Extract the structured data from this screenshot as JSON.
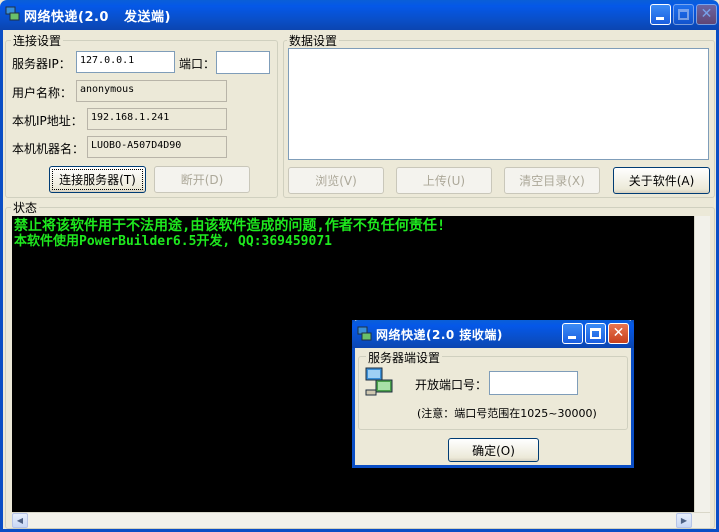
{
  "window": {
    "title": "网络快递(2.0   发送端)"
  },
  "connection": {
    "legend": "连接设置",
    "server_ip_label": "服务器IP：",
    "server_ip_value": "127.0.0.1",
    "port_label": "端口：",
    "port_value": "",
    "username_label": "用户名称：",
    "username_value": "anonymous",
    "local_ip_label": "本机IP地址：",
    "local_ip_value": "192.168.1.241",
    "local_host_label": "本机机器名：",
    "local_host_value": "LUOBO-A507D4D90",
    "connect_button": "连接服务器(T)",
    "disconnect_button": "断开(D)"
  },
  "data_settings": {
    "legend": "数据设置",
    "browse_button": "浏览(V)",
    "upload_button": "上传(U)",
    "clear_button": "清空目录(X)",
    "about_button": "关于软件(A)"
  },
  "status": {
    "legend": "状态",
    "lines": [
      "禁止将该软件用于不法用途,由该软件造成的问题,作者不负任何责任!",
      "本软件使用PowerBuilder6.5开发, QQ:369459071"
    ]
  },
  "dialog": {
    "title": "网络快递(2.0 接收端)",
    "legend": "服务器端设置",
    "open_port_label": "开放端口号：",
    "open_port_value": "",
    "note": "(注意：端口号范围在1025~30000)",
    "ok_button": "确定(O)"
  },
  "colors": {
    "titlebar": "#0a4ec5",
    "console_bg": "#000000",
    "console_text": "#1ee81e",
    "window_bg": "#ece9d8"
  }
}
